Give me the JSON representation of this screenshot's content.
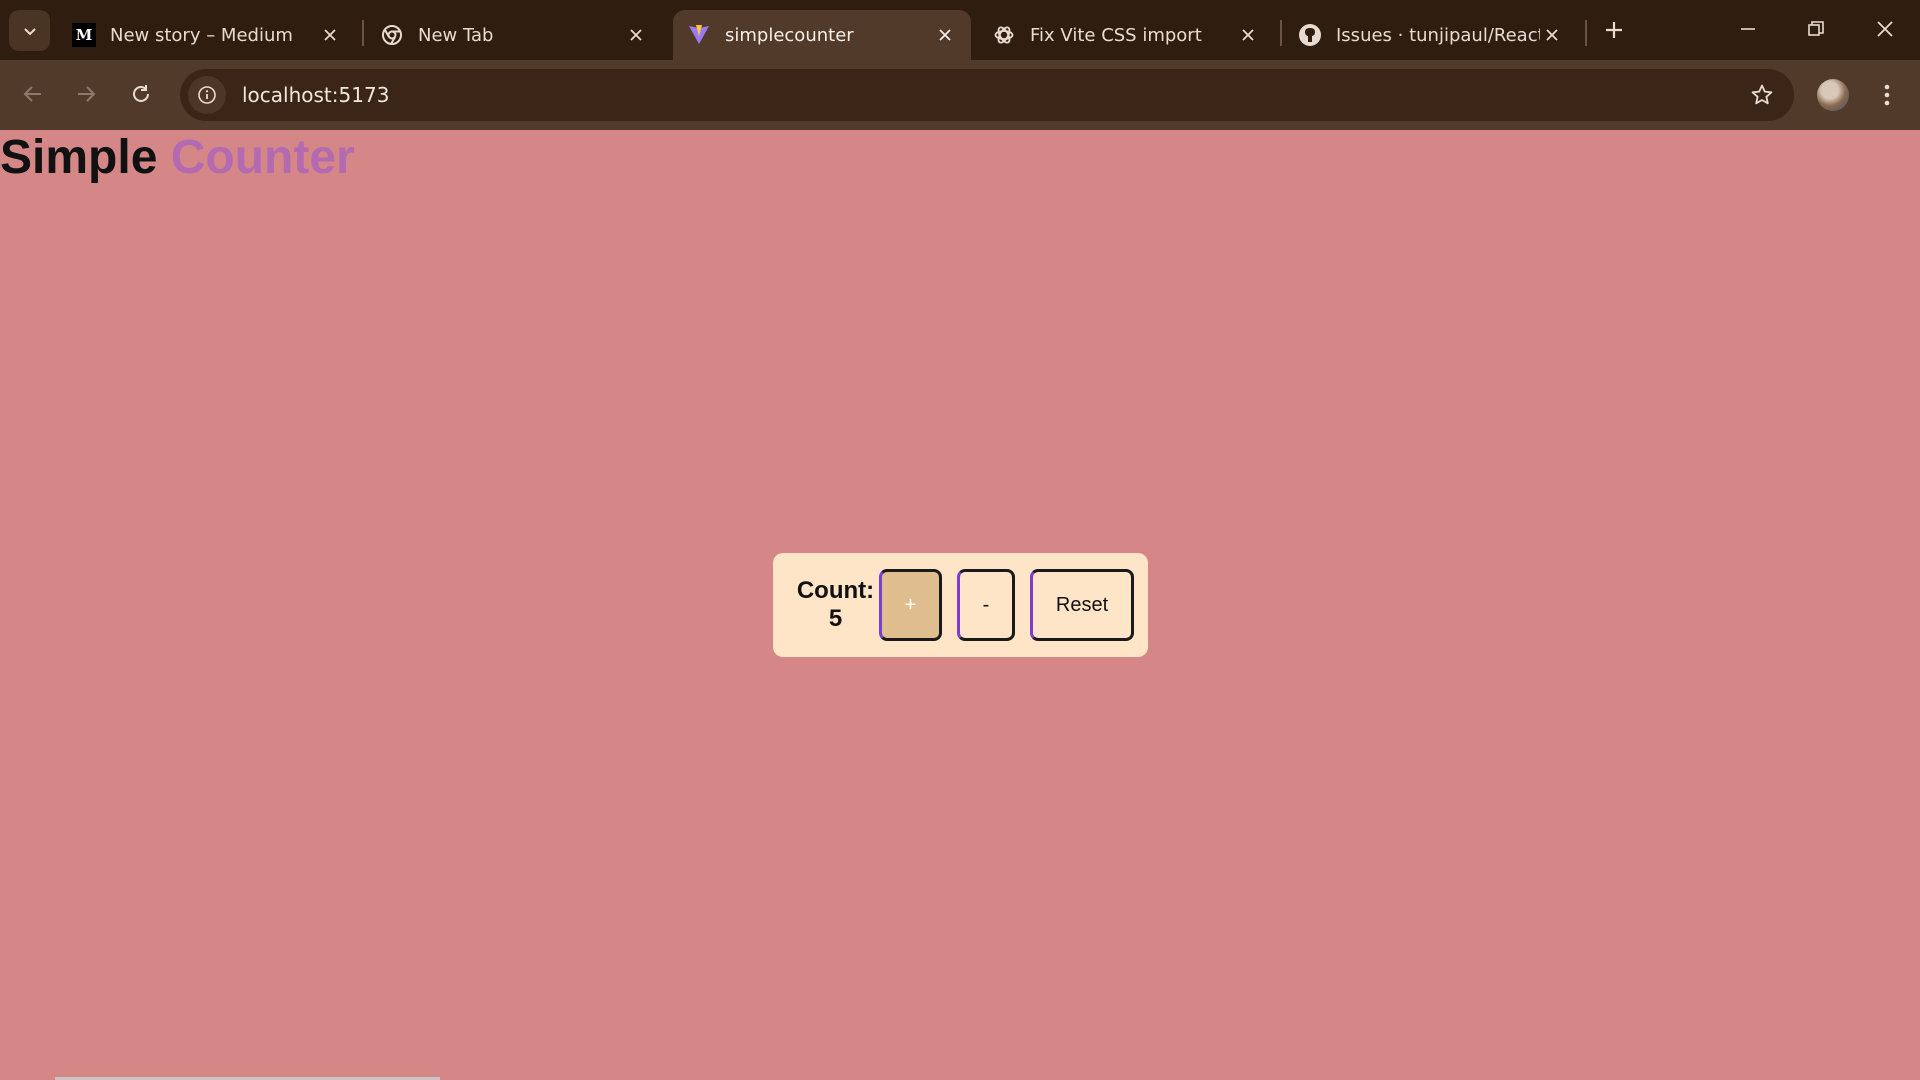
{
  "browser": {
    "tabs": [
      {
        "title": "New story – Medium",
        "favicon": "medium-logo-icon",
        "active": false
      },
      {
        "title": "New Tab",
        "favicon": "chrome-logo-icon",
        "active": false
      },
      {
        "title": "simplecounter",
        "favicon": "vite-logo-icon",
        "active": true
      },
      {
        "title": "Fix Vite CSS import",
        "favicon": "chatgpt-logo-icon",
        "active": false
      },
      {
        "title": "Issues · tunjipaul/React",
        "favicon": "github-logo-icon",
        "active": false
      }
    ],
    "medium_favicon_text": "M",
    "url": "localhost:5173"
  },
  "page": {
    "heading_word1": "Simple",
    "heading_word2": "Counter",
    "count_label": "Count:",
    "count_value": "5",
    "buttons": {
      "increment": "+",
      "decrement": "-",
      "reset": "Reset"
    }
  },
  "colors": {
    "page_background": "#d48786",
    "heading_accent": "#b46ab0",
    "card_background": "#ffe5c8",
    "increment_button": "#e0bd8e",
    "chrome_background": "#2f1d10",
    "active_tab": "#523a2a"
  }
}
